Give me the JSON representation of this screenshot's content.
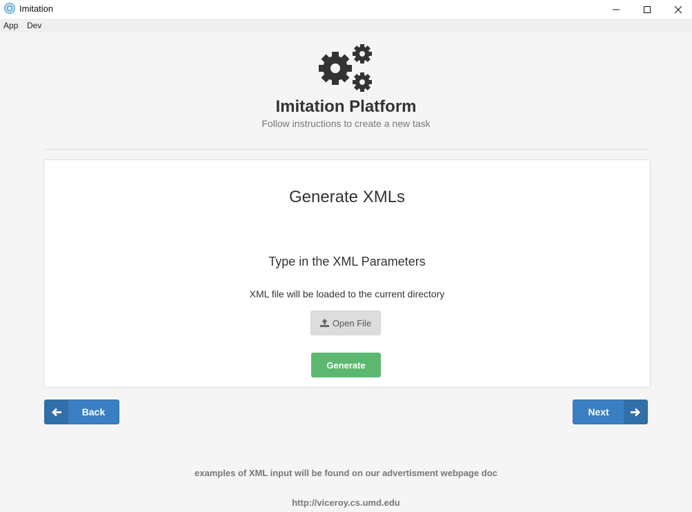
{
  "window": {
    "title": "Imitation",
    "icons": {
      "app": "electron-atom-icon",
      "minimize": "minimize-icon",
      "maximize": "maximize-icon",
      "close": "close-icon"
    }
  },
  "menu": {
    "items": [
      {
        "label": "App"
      },
      {
        "label": "Dev"
      }
    ]
  },
  "header": {
    "logo_icon": "gears-icon",
    "title": "Imitation Platform",
    "subtitle": "Follow instructions to create a new task"
  },
  "panel": {
    "title": "Generate XMLs",
    "subtitle": "Type in the XML Parameters",
    "note": "XML file will be loaded to the current directory",
    "open_file_label": "Open File",
    "open_file_icon": "upload-icon",
    "generate_label": "Generate"
  },
  "nav": {
    "back_label": "Back",
    "back_icon": "arrow-left-icon",
    "next_label": "Next",
    "next_icon": "arrow-right-icon"
  },
  "footer": {
    "note": "examples of XML input will be found on our advertisment webpage doc",
    "link": "http://viceroy.cs.umd.edu"
  },
  "colors": {
    "primary": "#3a7fc1",
    "success": "#5cb870",
    "background": "#f5f5f5",
    "panel": "#ffffff",
    "muted_text": "#777777"
  }
}
